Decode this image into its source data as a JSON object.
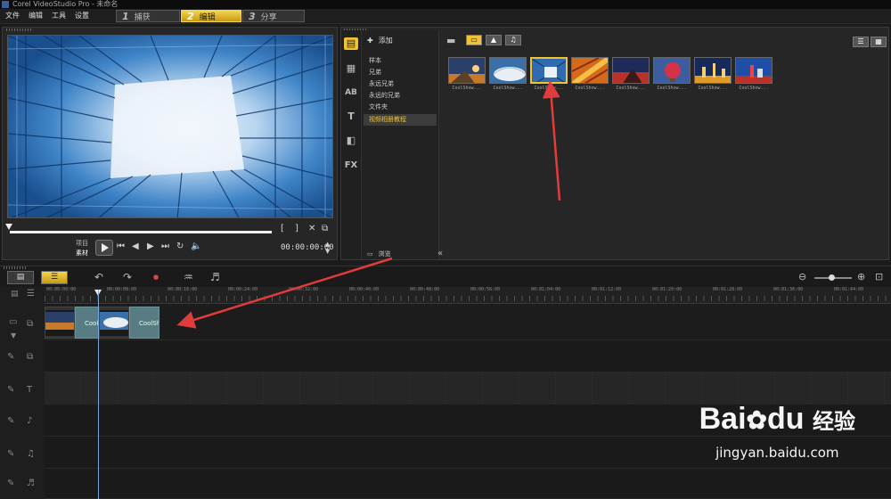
{
  "window": {
    "title": "Corel VideoStudio Pro - 未命名"
  },
  "menu": [
    "文件",
    "编辑",
    "工具",
    "设置"
  ],
  "steps": [
    {
      "num": "1",
      "label": "捕获"
    },
    {
      "num": "2",
      "label": "编辑"
    },
    {
      "num": "3",
      "label": "分享"
    }
  ],
  "preview": {
    "labels": {
      "project": "项目",
      "clip": "素材"
    },
    "timecode": "00:00:00:00",
    "scrub_position_percent": 0
  },
  "library": {
    "add_label": "添加",
    "folders": [
      "样本",
      "兄弟",
      "永远兄弟",
      "永远的兄弟",
      "文件夹",
      "视频相册教程"
    ],
    "selected_folder": "视频相册教程",
    "browse_label": "浏览",
    "side_icons": [
      "media-icon",
      "instant-project-icon",
      "transition-icon",
      "title-icon",
      "graphics-icon",
      "filter-icon"
    ],
    "side_icon_labels": {
      "title": "T",
      "filter": "FX"
    },
    "thumbnails": [
      {
        "label": "CoolShow...",
        "selected": false
      },
      {
        "label": "CoolShow...",
        "selected": false
      },
      {
        "label": "CoolShow...",
        "selected": true
      },
      {
        "label": "CoolShow...",
        "selected": false
      },
      {
        "label": "CoolShow...",
        "selected": false
      },
      {
        "label": "CoolShow...",
        "selected": false
      },
      {
        "label": "CoolShow...",
        "selected": false
      },
      {
        "label": "CoolShow...",
        "selected": false
      }
    ]
  },
  "timeline": {
    "ruler": [
      "00:00:00:00",
      "00:00:08:00",
      "00:00:16:00",
      "00:00:24:00",
      "00:00:32:00",
      "00:00:40:00",
      "00:00:48:00",
      "00:00:56:00",
      "00:01:04:00",
      "00:01:12:00",
      "00:01:20:00",
      "00:01:28:00",
      "00:01:36:00",
      "00:01:44:00"
    ],
    "clips": [
      {
        "type": "video",
        "label": ""
      },
      {
        "type": "transition",
        "label": "CoolSh"
      },
      {
        "type": "video",
        "label": ""
      },
      {
        "type": "transition",
        "label": "CoolSh"
      }
    ]
  },
  "watermark": {
    "brand_left": "Bai",
    "brand_right": "du",
    "brand_cn": "经验",
    "url": "jingyan.baidu.com"
  },
  "colors": {
    "accent": "#f1c232",
    "arrow": "#e23b3b",
    "playhead": "#7aa7d8"
  }
}
